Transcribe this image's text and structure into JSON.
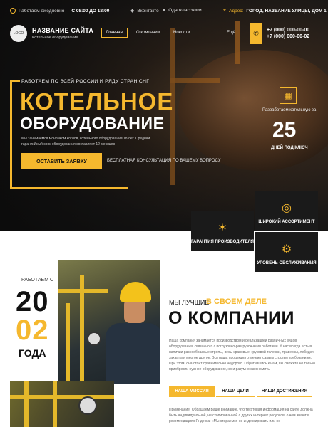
{
  "topbar": {
    "hours_label": "Работаем ежедневно",
    "hours_value": "С 08:00 ДО 18:00",
    "vk": "Вконтакте",
    "ok": "Одноклассники",
    "address_label": "Адрес:",
    "address_value": "ГОРОД, НАЗВАНИЕ УЛИЦЫ, ДОМ 1"
  },
  "header": {
    "logo_text": "LOGO",
    "site_name": "НАЗВАНИЕ САЙТА",
    "site_sub": "Котельное оборудование",
    "nav": [
      "Главная",
      "О компании",
      "Новости",
      "Ещё"
    ],
    "phone1": "+7 (000) 000-00-00",
    "phone2": "+7 (000) 000-00-02"
  },
  "hero": {
    "pre": "РАБОТАЕМ ПО ВСЕЙ РОССИИ И РЯДУ СТРАН СНГ",
    "title1": "КОТЕЛЬНОЕ",
    "title2": "ОБОРУДОВАНИЕ",
    "desc": "Мы занимаемся монтажом котлов, котельного оборудования 18 лет. Средний гарантийный срок оборудования составляет 12 месяцев",
    "cta": "ОСТАВИТЬ ЗАЯВКУ",
    "cta_note": "БЕСПЛАТНАЯ КОНСУЛЬТАЦИЯ ПО ВАШЕМУ ВОПРОСУ",
    "side_text": "Разработаем котельную за",
    "side_number": "25",
    "side_sub": "ДНЕЙ ПОД КЛЮЧ"
  },
  "features": [
    {
      "label": "ШИРОКИЙ АССОРТИМЕНТ",
      "icon": "gauge-icon"
    },
    {
      "label": "ГАРАНТИЯ ПРОИЗВОДИТЕЛЯ",
      "icon": "star-hand-icon"
    },
    {
      "label": "УРОВЕНЬ ОБСЛУЖИВАНИЯ",
      "icon": "gears-icon"
    }
  ],
  "about": {
    "since_label": "РАБОТАЕМ С",
    "year1": "20",
    "year2": "02",
    "years_label": "ГОДА",
    "pre": "МЫ ЛУЧШИЕ",
    "highlight": "В СВОЕМ ДЕЛЕ",
    "title": "О КОМПАНИИ",
    "text": "Наша компания занимается производством и реализацией различных видов оборудования, связанного с погрузочно-разгрузочными работами. У нас всегда есть в наличии разнообразные стропы, весы крановые, грузовой тележки, траверсы, лебедки, захваты и многое другое. Вся наша продукция отвечает самым строгим требованиям. При этом, она стоит сравнительно недорого. Обратившись к нам, вы сможете не только приобрести нужное оборудование, но и разумно сэкономить.",
    "tabs": [
      "НАША МИССИЯ",
      "НАШИ ЦЕЛИ",
      "НАШИ ДОСТИЖЕНИЯ"
    ],
    "note": "Примечание: Обращаем Ваше внимание, что текстовая информация на сайте должна быть индивидуальной, не скопированной с других интернет ресурсов, о чем знают в рекомендациях Яндекса: «Мы стараемся не индексировать или не"
  },
  "colors": {
    "accent": "#f5b82e",
    "dark": "#1a1a1a"
  }
}
